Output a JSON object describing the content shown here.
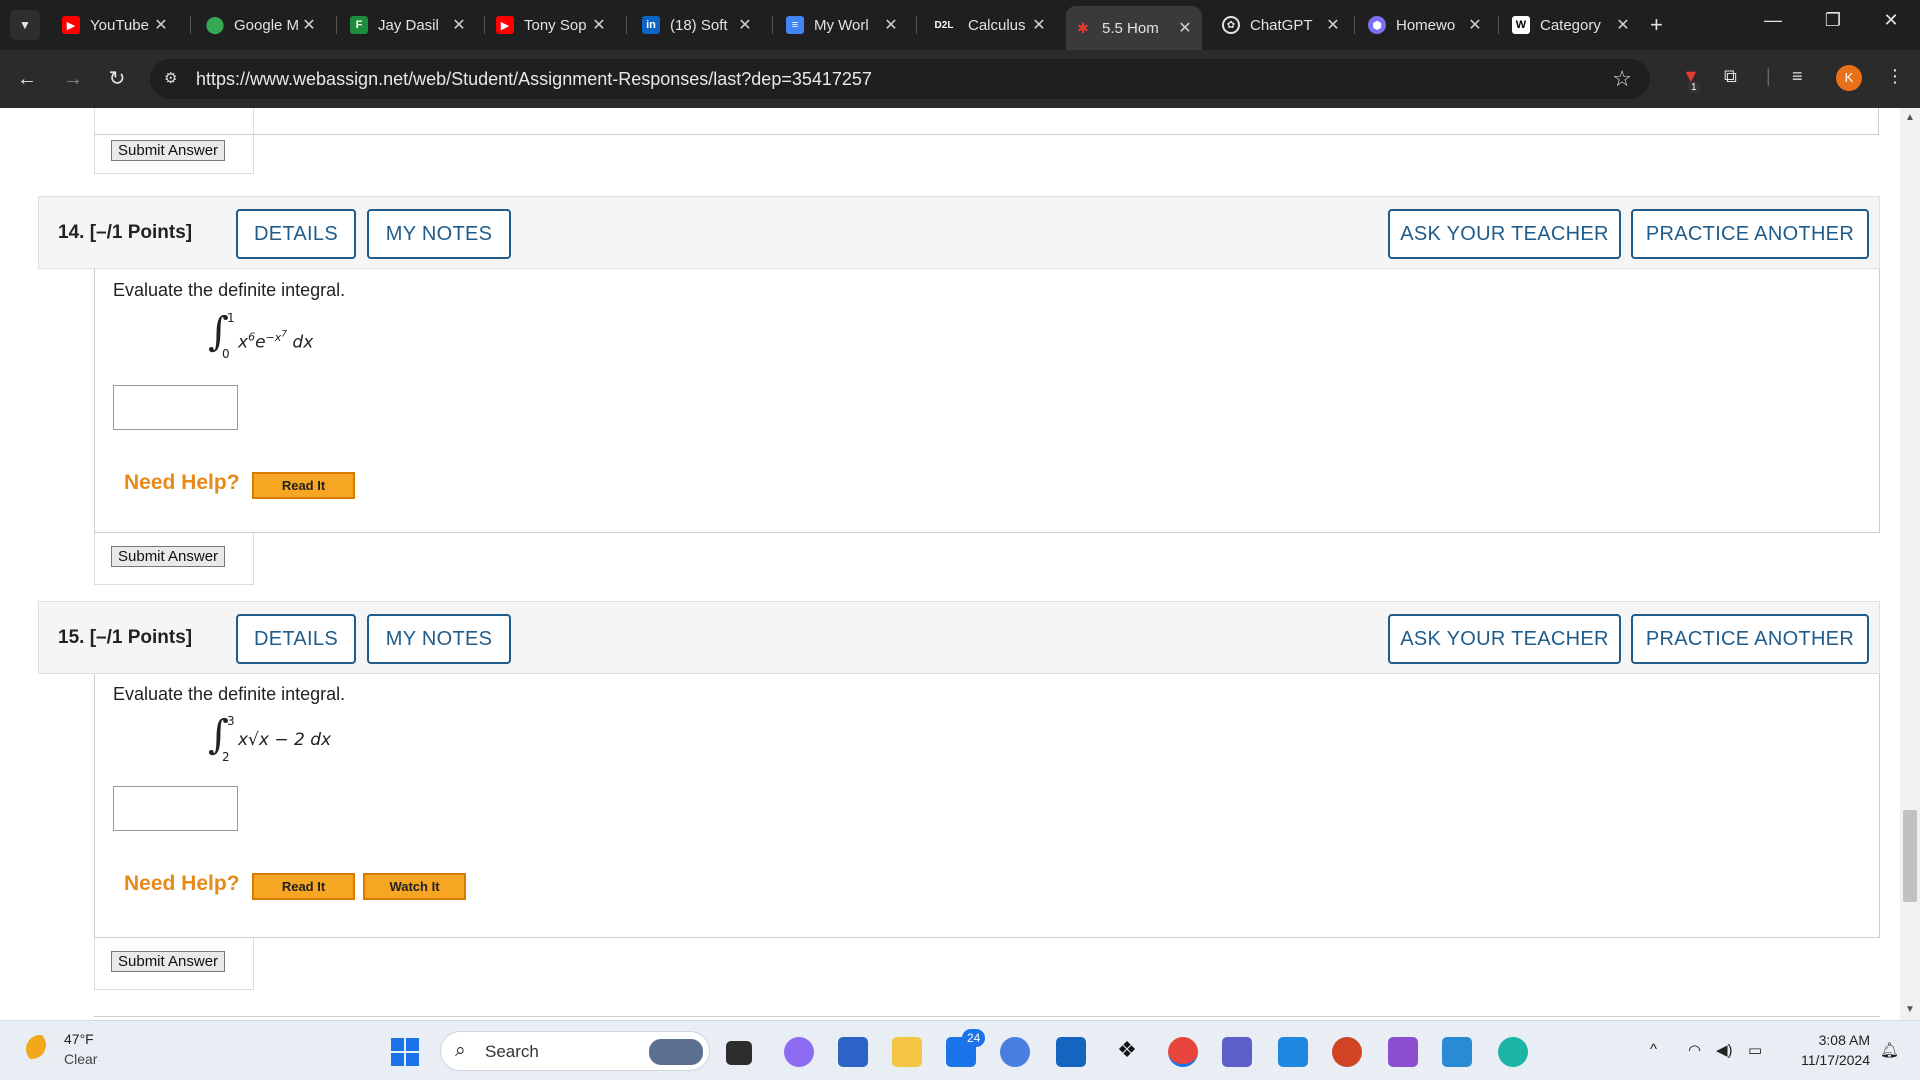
{
  "browser": {
    "tabs": [
      {
        "label": "YouTube",
        "icon": "youtube-icon",
        "color": "#ff0000"
      },
      {
        "label": "Google M",
        "icon": "maps-pin-icon",
        "color": "#34a853"
      },
      {
        "label": "Jay Dasil",
        "icon": "sheet-icon",
        "color": "#1e8e3e"
      },
      {
        "label": "Tony Sop",
        "icon": "youtube-icon",
        "color": "#ff0000"
      },
      {
        "label": "(18) Soft",
        "icon": "linkedin-icon",
        "color": "#0a66c2"
      },
      {
        "label": "My Worl",
        "icon": "docs-icon",
        "color": "#4285f4"
      },
      {
        "label": "Calculus",
        "icon": "d2l-icon",
        "color": "#000000"
      },
      {
        "label": "5.5 Hom",
        "icon": "webassign-icon",
        "color": "#c62828"
      },
      {
        "label": "ChatGPT",
        "icon": "chatgpt-icon",
        "color": "#ffffff"
      },
      {
        "label": "Homewo",
        "icon": "hexagon-icon",
        "color": "#7c6ff0"
      },
      {
        "label": "Category",
        "icon": "wikipedia-icon",
        "color": "#ffffff"
      }
    ],
    "active_tab_index": 7,
    "d2l_badge": "D2L",
    "w_badge": "W",
    "in_badge": "in",
    "url": "https://www.webassign.net/web/Student/Assignment-Responses/last?dep=35417257",
    "profile_initial": "K",
    "extension_badge": "1"
  },
  "questions": [
    {
      "number_label": "14.  [–/1 Points]",
      "details_label": "DETAILS",
      "notes_label": "MY NOTES",
      "ask_label": "ASK YOUR TEACHER",
      "practice_label": "PRACTICE ANOTHER",
      "prompt": "Evaluate the definite integral.",
      "integral": {
        "upper": "1",
        "lower": "0",
        "integrand": "x",
        "exp1": "6",
        "mid": "e",
        "exp2": "−x",
        "exp3": "7",
        "tail": " dx"
      },
      "answer_value": "",
      "help_label": "Need Help?",
      "help_buttons": [
        "Read It"
      ],
      "submit_label": "Submit Answer"
    },
    {
      "number_label": "15.  [–/1 Points]",
      "details_label": "DETAILS",
      "notes_label": "MY NOTES",
      "ask_label": "ASK YOUR TEACHER",
      "practice_label": "PRACTICE ANOTHER",
      "prompt": "Evaluate the definite integral.",
      "integral": {
        "upper": "3",
        "lower": "2",
        "integrand": "x√x − 2 dx"
      },
      "answer_value": "",
      "help_label": "Need Help?",
      "help_buttons": [
        "Read It",
        "Watch It"
      ],
      "submit_label": "Submit Answer"
    }
  ],
  "previous_submit_label": "Submit Answer",
  "taskbar": {
    "weather_temp": "47°F",
    "weather_cond": "Clear",
    "search_label": "Search",
    "mail_badge": "24",
    "time": "3:08 AM",
    "date": "11/17/2024"
  },
  "accent_color": "#1f5c8c",
  "help_color": "#e68a1a"
}
